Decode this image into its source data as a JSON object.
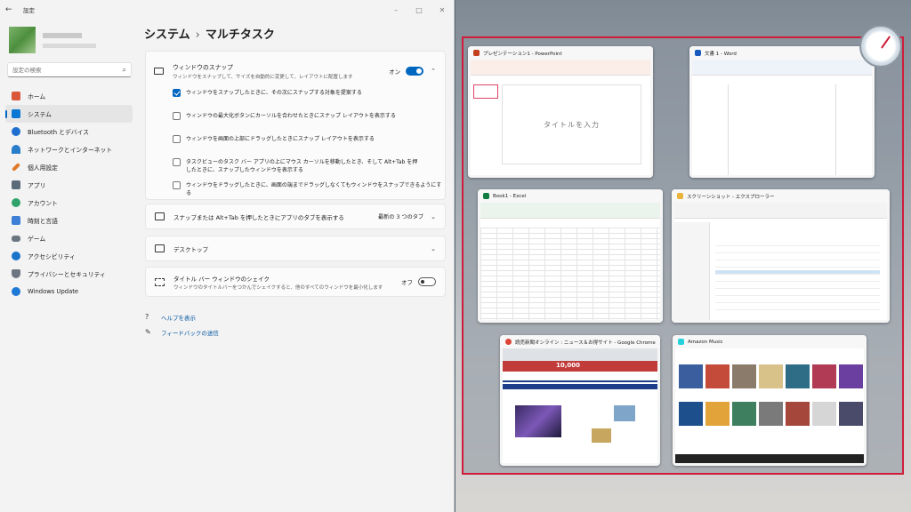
{
  "window": {
    "title": "設定",
    "back_icon": "arrow-left-icon"
  },
  "search": {
    "placeholder": "設定の検索"
  },
  "nav": [
    {
      "label": "ホーム",
      "icon": "home-icon",
      "color": "#d9573c",
      "active": false
    },
    {
      "label": "システム",
      "icon": "system-icon",
      "color": "#0a78d4",
      "active": true
    },
    {
      "label": "Bluetooth とデバイス",
      "icon": "bluetooth-icon",
      "color": "#1e6fd0",
      "active": false
    },
    {
      "label": "ネットワークとインターネット",
      "icon": "network-icon",
      "color": "#2a7ec9",
      "active": false
    },
    {
      "label": "個人用設定",
      "icon": "brush-icon",
      "color": "#e0792a",
      "active": false
    },
    {
      "label": "アプリ",
      "icon": "apps-icon",
      "color": "#5b6b7a",
      "active": false
    },
    {
      "label": "アカウント",
      "icon": "account-icon",
      "color": "#2fa36b",
      "active": false
    },
    {
      "label": "時刻と言語",
      "icon": "clock-language-icon",
      "color": "#3d7fd6",
      "active": false
    },
    {
      "label": "ゲーム",
      "icon": "game-icon",
      "color": "#6b7580",
      "active": false
    },
    {
      "label": "アクセシビリティ",
      "icon": "accessibility-icon",
      "color": "#1a73c9",
      "active": false
    },
    {
      "label": "プライバシーとセキュリティ",
      "icon": "shield-icon",
      "color": "#6c7681",
      "active": false
    },
    {
      "label": "Windows Update",
      "icon": "update-icon",
      "color": "#1d78d6",
      "active": false
    }
  ],
  "breadcrumb": {
    "parent": "システム",
    "separator": "›",
    "current": "マルチタスク"
  },
  "snap": {
    "title": "ウィンドウのスナップ",
    "description": "ウィンドウをスナップして、サイズを自動的に変更して、レイアウトに配置します",
    "state": "オン",
    "options": [
      {
        "text": "ウィンドウをスナップしたときに、その次にスナップする対象を提案する",
        "checked": true
      },
      {
        "text": "ウィンドウの最大化ボタンにカーソルを合わせたときにスナップ レイアウトを表示する",
        "checked": false
      },
      {
        "text": "ウィンドウを画面の上部にドラッグしたときにスナップ レイアウトを表示する",
        "checked": false
      },
      {
        "text": "タスクビューのタスク バー アプリの上にマウス カーソルを移動したとき、そして Alt+Tab を押したときに、スナップしたウィンドウを表示する",
        "checked": false
      },
      {
        "text": "ウィンドウをドラッグしたときに、画面の端までドラッグしなくてもウィンドウをスナップできるようにする",
        "checked": false
      }
    ]
  },
  "tabs_setting": {
    "label": "スナップまたは Alt+Tab を押したときにアプリのタブを表示する",
    "value": "最新の 3 つのタブ"
  },
  "desktops": {
    "label": "デスクトップ"
  },
  "shake": {
    "title": "タイトル バー ウィンドウのシェイク",
    "description": "ウィンドウのタイトルバーをつかんでシェイクすると、他のすべてのウィンドウを最小化します",
    "state": "オフ"
  },
  "links": {
    "help": "ヘルプを表示",
    "feedback": "フィードバックの送信"
  },
  "thumbnails": [
    {
      "title": "プレゼンテーション1 - PowerPoint",
      "icon": "powerpoint-icon",
      "color": "#c43e1c",
      "body_text": "タイトルを入力"
    },
    {
      "title": "文書 1 - Word",
      "icon": "word-icon",
      "color": "#185abd"
    },
    {
      "title": "Book1 - Excel",
      "icon": "excel-icon",
      "color": "#107c41"
    },
    {
      "title": "スクリーンショット - エクスプローラー",
      "icon": "folder-icon",
      "color": "#e8b53a"
    },
    {
      "title": "読売新聞オンライン : ニュース＆お得サイト - Google Chrome",
      "icon": "chrome-icon",
      "color": "#db4437",
      "banner_text": "10,000"
    },
    {
      "title": "Amazon Music",
      "icon": "amazon-music-icon",
      "color": "#25d1da"
    }
  ]
}
